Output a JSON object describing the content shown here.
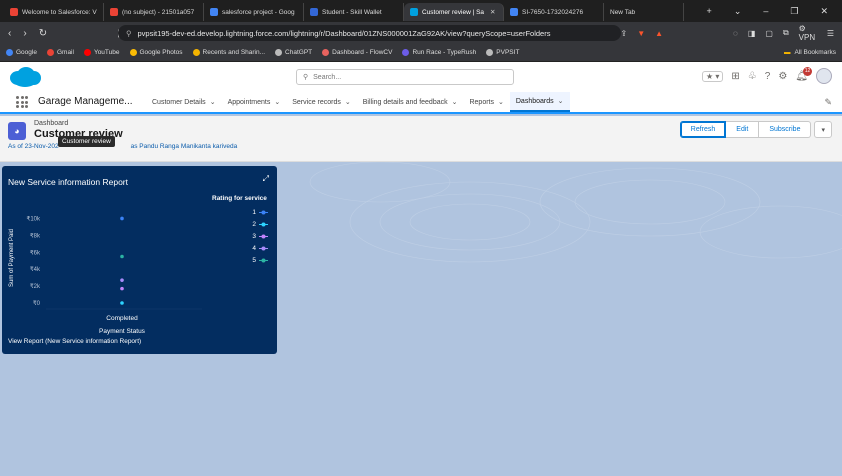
{
  "browser": {
    "tabs": [
      {
        "label": "Welcome to Salesforce: V",
        "color": "#ea4335",
        "active": false
      },
      {
        "label": "(no subject) - 21501a057",
        "color": "#ea4335",
        "active": false
      },
      {
        "label": "salesforce project - Goog",
        "color": "#4285f4",
        "active": false
      },
      {
        "label": "Student - Skill Wallet",
        "color": "#3367d6",
        "active": false
      },
      {
        "label": "Customer review | Sa",
        "color": "#00a1e0",
        "active": true
      },
      {
        "label": "SI-7650-1732024276",
        "color": "#4285f4",
        "active": false
      },
      {
        "label": "New Tab",
        "color": "",
        "active": false
      }
    ],
    "url": "pvpsit195-dev-ed.develop.lightning.force.com/lightning/r/Dashboard/01ZNS000001ZaG92AK/view?queryScope=userFolders",
    "vpn_label": "VPN",
    "bookmarks": [
      {
        "label": "Google",
        "color": "#4285f4"
      },
      {
        "label": "Gmail",
        "color": "#ea4335"
      },
      {
        "label": "YouTube",
        "color": "#ff0000"
      },
      {
        "label": "Google Photos",
        "color": "#fbbc05"
      },
      {
        "label": "Recents and Sharin...",
        "color": "#f4b400"
      },
      {
        "label": "ChatGPT",
        "color": "#bbbbbb"
      },
      {
        "label": "Dashboard - FlowCV",
        "color": "#e8635f"
      },
      {
        "label": "Run Race - TypeRush",
        "color": "#6c5ce7"
      },
      {
        "label": "PVPSIT",
        "color": "#bbbbbb"
      }
    ],
    "all_bookmarks_label": "All Bookmarks"
  },
  "header": {
    "search_placeholder": "Search...",
    "notification_count": "12"
  },
  "appnav": {
    "app_name": "Garage Manageme...",
    "items": [
      {
        "label": "Customer Details",
        "active": false
      },
      {
        "label": "Appointments",
        "active": false
      },
      {
        "label": "Service records",
        "active": false
      },
      {
        "label": "Billing details and feedback",
        "active": false
      },
      {
        "label": "Reports",
        "active": false
      },
      {
        "label": "Dashboards",
        "active": true
      }
    ]
  },
  "dashboard": {
    "type_label": "Dashboard",
    "title": "Customer review",
    "meta_prefix": "As of 23-Nov-202",
    "meta_suffix": "as Pandu Ranga Manikanta kariveda",
    "tooltip": "Customer review",
    "buttons": {
      "refresh": "Refresh",
      "edit": "Edit",
      "subscribe": "Subscribe"
    }
  },
  "widget": {
    "title": "New Service information Report",
    "footer_link": "View Report (New Service information Report)"
  },
  "chart_data": {
    "type": "scatter",
    "title": "",
    "xlabel": "Payment Status",
    "ylabel": "Sum of Payment Paid",
    "categories": [
      "Completed"
    ],
    "y_ticks": [
      "₹0",
      "₹2k",
      "₹4k",
      "₹6k",
      "₹8k",
      "₹10k"
    ],
    "ylim": [
      0,
      11000
    ],
    "legend_title": "Rating for service",
    "legend_position": "right",
    "grid": false,
    "series": [
      {
        "name": "1",
        "color": "#3b82f6",
        "values": [
          10000
        ]
      },
      {
        "name": "2",
        "color": "#2dd4ff",
        "values": [
          0
        ]
      },
      {
        "name": "3",
        "color": "#c084fc",
        "values": [
          1700
        ]
      },
      {
        "name": "4",
        "color": "#a78bfa",
        "values": [
          2700
        ]
      },
      {
        "name": "5",
        "color": "#2bb3a3",
        "values": [
          5500
        ]
      }
    ]
  }
}
